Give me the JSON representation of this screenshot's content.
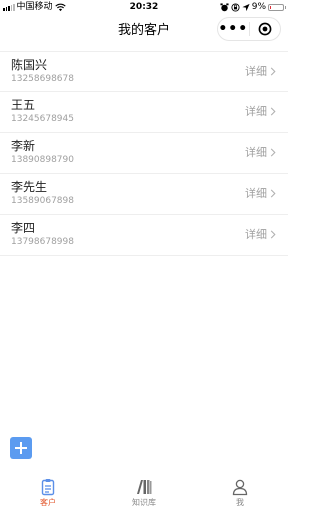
{
  "status_bar": {
    "carrier": "中国移动",
    "time": "20:32",
    "battery": "9%",
    "battery_level": 0.09
  },
  "nav": {
    "title": "我的客户",
    "more_label": "•••"
  },
  "customers": [
    {
      "name": "陈国兴",
      "phone": "13258698678",
      "detail": "详细"
    },
    {
      "name": "王五",
      "phone": "13245678945",
      "detail": "详细"
    },
    {
      "name": "李新",
      "phone": "13890898790",
      "detail": "详细"
    },
    {
      "name": "李先生",
      "phone": "13589067898",
      "detail": "详细"
    },
    {
      "name": "李四",
      "phone": "13798678998",
      "detail": "详细"
    }
  ],
  "tabs": [
    {
      "label": "客户",
      "icon": "clipboard-icon",
      "active": true
    },
    {
      "label": "知识库",
      "icon": "books-icon",
      "active": false
    },
    {
      "label": "我",
      "icon": "person-icon",
      "active": false
    }
  ],
  "colors": {
    "accent": "#e2572c",
    "add_button": "#5b9bf0",
    "secondary_text": "#a0a0a0"
  }
}
